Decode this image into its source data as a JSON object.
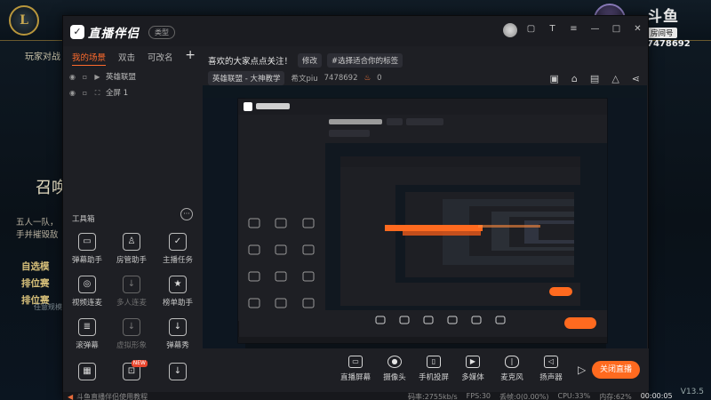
{
  "lol": {
    "tab": "玩家对战",
    "summon_title": "召唤",
    "desc_lines": [
      "五人一队，",
      "手并摧毁敌"
    ],
    "modes": [
      "自选模",
      "排位赛",
      "排位赛"
    ],
    "mode_sub": "任意规模",
    "room_logo": "斗鱼",
    "room_label": "房间号",
    "room_id": "7478692",
    "version": "V13.5"
  },
  "app": {
    "brand_name": "直播伴侣",
    "brand_badge": "类型",
    "scenes": {
      "tabs": [
        "我的场景",
        "双击",
        "可改名"
      ],
      "active_tab_index": 0,
      "add_label": "+",
      "items": [
        {
          "label": "英雄联盟"
        },
        {
          "label": "全屏 1"
        }
      ]
    },
    "tools": {
      "title": "工具箱",
      "more_label": "···",
      "items": [
        {
          "label": "弹幕助手",
          "icon": "chat-icon",
          "hot": false,
          "enabled": true
        },
        {
          "label": "房管助手",
          "icon": "admin-icon",
          "hot": false,
          "enabled": true
        },
        {
          "label": "主播任务",
          "icon": "task-icon",
          "hot": false,
          "enabled": true
        },
        {
          "label": "视频连麦",
          "icon": "video-link-icon",
          "hot": false,
          "enabled": true
        },
        {
          "label": "多人连麦",
          "icon": "multi-link-icon",
          "hot": false,
          "enabled": false
        },
        {
          "label": "榜单助手",
          "icon": "rank-icon",
          "hot": false,
          "enabled": true
        },
        {
          "label": "滚弹幕",
          "icon": "scroll-icon",
          "hot": false,
          "enabled": true
        },
        {
          "label": "虚拟形象",
          "icon": "avatar-icon",
          "hot": false,
          "enabled": false
        },
        {
          "label": "弹幕秀",
          "icon": "show-icon",
          "hot": false,
          "enabled": true
        },
        {
          "label": "",
          "icon": "grid-icon",
          "hot": false,
          "enabled": true
        },
        {
          "label": "",
          "icon": "gift-icon",
          "hot": true,
          "hot_label": "NEW",
          "enabled": true
        },
        {
          "label": "",
          "icon": "download-icon",
          "hot": false,
          "enabled": true
        }
      ]
    },
    "room": {
      "title": "喜欢的大家点点关注！",
      "edit_label": "修改",
      "tag_label": "#选择适合你的标签",
      "category": "英雄联盟 - 大神教学",
      "streamer": "希文piu",
      "room_id": "7478692",
      "hot_count": "0"
    },
    "controls": [
      {
        "label": "直播屏幕",
        "icon": "screen-icon"
      },
      {
        "label": "摄像头",
        "icon": "camera-icon"
      },
      {
        "label": "手机投屏",
        "icon": "phone-cast-icon"
      },
      {
        "label": "多媒体",
        "icon": "media-icon"
      },
      {
        "label": "麦克风",
        "icon": "mic-icon"
      },
      {
        "label": "扬声器",
        "icon": "speaker-icon"
      }
    ],
    "go_live_label": "关闭直播",
    "status": {
      "left": "斗鱼直播伴侣使用教程",
      "bitrate": "码率:2755kb/s",
      "fps": "FPS:30",
      "dropped": "丢帧:0(0.00%)",
      "cpu": "CPU:33%",
      "memory": "内存:62%",
      "timer": "00:00:05"
    },
    "version": "V13.5"
  }
}
